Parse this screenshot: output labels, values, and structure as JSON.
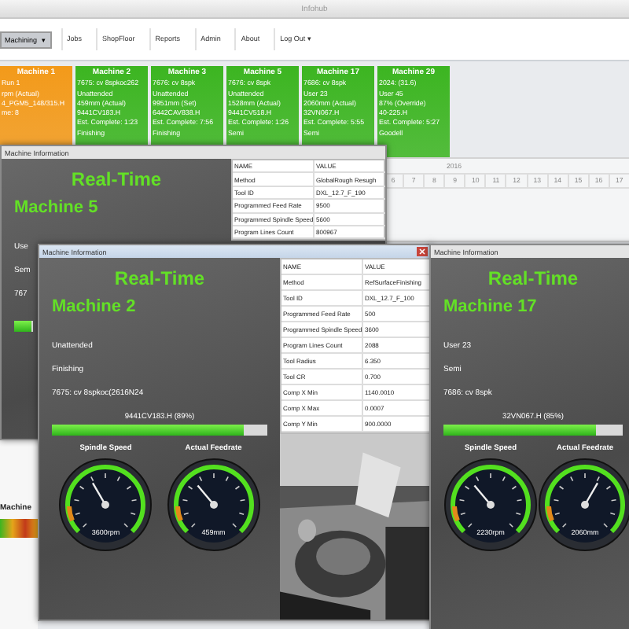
{
  "window": {
    "title": "Infohub"
  },
  "toolbar": {
    "dropdown": "Machining",
    "dropdown_caret": "▾",
    "items": [
      "Jobs",
      "ShopFloor",
      "Reports",
      "Admin",
      "About"
    ],
    "logout": "Log Out",
    "logout_caret": "▾"
  },
  "tiles": [
    {
      "name": "Machine 1",
      "color": "#f39a1a",
      "lines": [
        "Run 1",
        "rpm (Actual)",
        "4_PGM5_148/315.H",
        "me: 8"
      ]
    },
    {
      "name": "Machine 2",
      "color": "#3cb521",
      "lines": [
        "7675: cv 8spkoc262",
        "Unattended",
        "459mm (Actual)",
        "9441CV183.H",
        "Est. Complete: 1:23",
        "Finishing"
      ]
    },
    {
      "name": "Machine 3",
      "color": "#3cb521",
      "lines": [
        "7676: cv 8spk",
        "Unattended",
        "9951mm (Set)",
        "6442CAV838.H",
        "Est. Complete: 7:56",
        "Finishing"
      ]
    },
    {
      "name": "Machine 5",
      "color": "#3cb521",
      "lines": [
        "7676: cv 8spk",
        "Unattended",
        "1528mm (Actual)",
        "9441CV518.H",
        "Est. Complete: 1:26",
        "Semi"
      ]
    },
    {
      "name": "Machine 17",
      "color": "#3cb521",
      "lines": [
        "7686: cv 8spk",
        "User 23",
        "2060mm (Actual)",
        "32VN067.H",
        "Est. Complete: 5:55",
        "Semi"
      ]
    },
    {
      "name": "Machine 29",
      "color": "#3cb521",
      "lines": [
        "2024: (31.6)",
        "User 45",
        "87% (Override)",
        "40-225.H",
        "Est. Complete: 5:27",
        "Goodell"
      ]
    }
  ],
  "schedule": {
    "year": "2016",
    "days": [
      "6",
      "7",
      "8",
      "9",
      "10",
      "11",
      "12",
      "13",
      "14",
      "15",
      "16",
      "17"
    ]
  },
  "side_panel": {
    "label": "Machine"
  },
  "windows": [
    {
      "title": "Machine Information",
      "heading": "Real-Time",
      "machine": "Machine 5",
      "status_lines": [
        "Use",
        "Sem",
        "767"
      ],
      "progress": {
        "level": 0.89
      },
      "table": {
        "columns": [
          "NAME",
          "VALUE"
        ],
        "rows": [
          [
            "Method",
            "GlobalRough Resugh"
          ],
          [
            "Tool ID",
            "DXL_12.7_F_190"
          ],
          [
            "Programmed Feed Rate",
            "9500"
          ],
          [
            "Programmed Spindle Speed",
            "5600"
          ],
          [
            "Program Lines Count",
            "800967"
          ]
        ]
      }
    },
    {
      "title": "Machine Information",
      "closable": true,
      "heading": "Real-Time",
      "machine": "Machine 2",
      "status_lines": [
        "Unattended",
        "Finishing",
        "7675: cv 8spkoc(2616N24"
      ],
      "progress": {
        "label": "9441CV183.H (89%)",
        "level": 0.89
      },
      "gauges": [
        {
          "label": "Spindle Speed",
          "reading": "3600rpm"
        },
        {
          "label": "Actual Feedrate",
          "reading": "459mm"
        }
      ],
      "table": {
        "columns": [
          "NAME",
          "VALUE"
        ],
        "rows": [
          [
            "Method",
            "RefSurfaceFinishing"
          ],
          [
            "Tool ID",
            "DXL_12.7_F_100"
          ],
          [
            "Programmed Feed Rate",
            "500"
          ],
          [
            "Programmed Spindle Speed",
            "3600"
          ],
          [
            "Program Lines Count",
            "2088"
          ],
          [
            "Tool Radius",
            "6.350"
          ],
          [
            "Tool CR",
            "0.700"
          ],
          [
            "Comp X Min",
            "1140.0010"
          ],
          [
            "Comp X Max",
            "0.0007"
          ],
          [
            "Comp Y Min",
            "900.0000"
          ]
        ]
      },
      "photo": {
        "kind": "picture"
      }
    },
    {
      "title": "Machine Information",
      "heading": "Real-Time",
      "machine": "Machine 17",
      "status_lines": [
        "User 23",
        "Semi",
        "7686: cv 8spk"
      ],
      "progress": {
        "label": "32VN067.H (85%)",
        "level": 0.85
      },
      "gauges": [
        {
          "label": "Spindle Speed",
          "reading": "2230rpm"
        },
        {
          "label": "Actual Feedrate",
          "reading": "2060mm"
        }
      ]
    }
  ]
}
